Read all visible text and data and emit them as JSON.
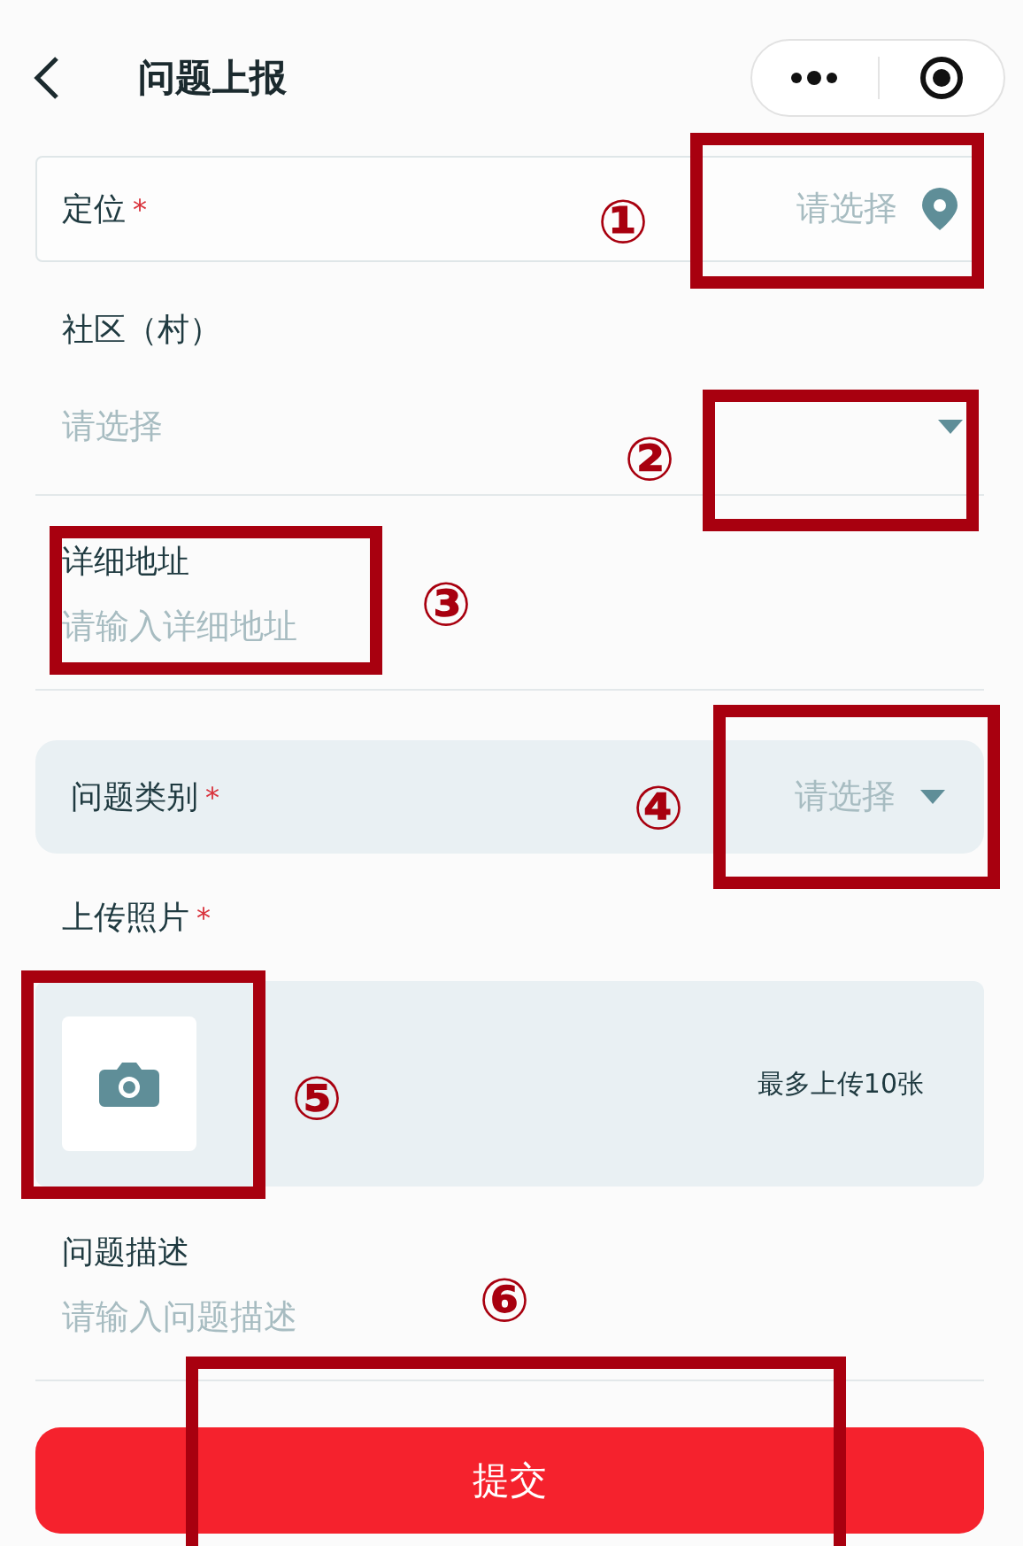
{
  "header": {
    "title": "问题上报"
  },
  "location": {
    "label": "定位",
    "mark": "*",
    "placeholder": "请选择"
  },
  "community": {
    "label": "社区（村）",
    "placeholder": "请选择"
  },
  "address": {
    "label": "详细地址",
    "placeholder": "请输入详细地址"
  },
  "category": {
    "label": "问题类别",
    "mark": "*",
    "placeholder": "请选择"
  },
  "photos": {
    "label": "上传照片",
    "mark": "*",
    "hint": "最多上传10张"
  },
  "description": {
    "label": "问题描述",
    "placeholder": "请输入问题描述"
  },
  "submit": "提交",
  "annotations": [
    {
      "number": "①"
    },
    {
      "number": "②"
    },
    {
      "number": "③"
    },
    {
      "number": "④"
    },
    {
      "number": "⑤"
    },
    {
      "number": "⑥"
    }
  ]
}
